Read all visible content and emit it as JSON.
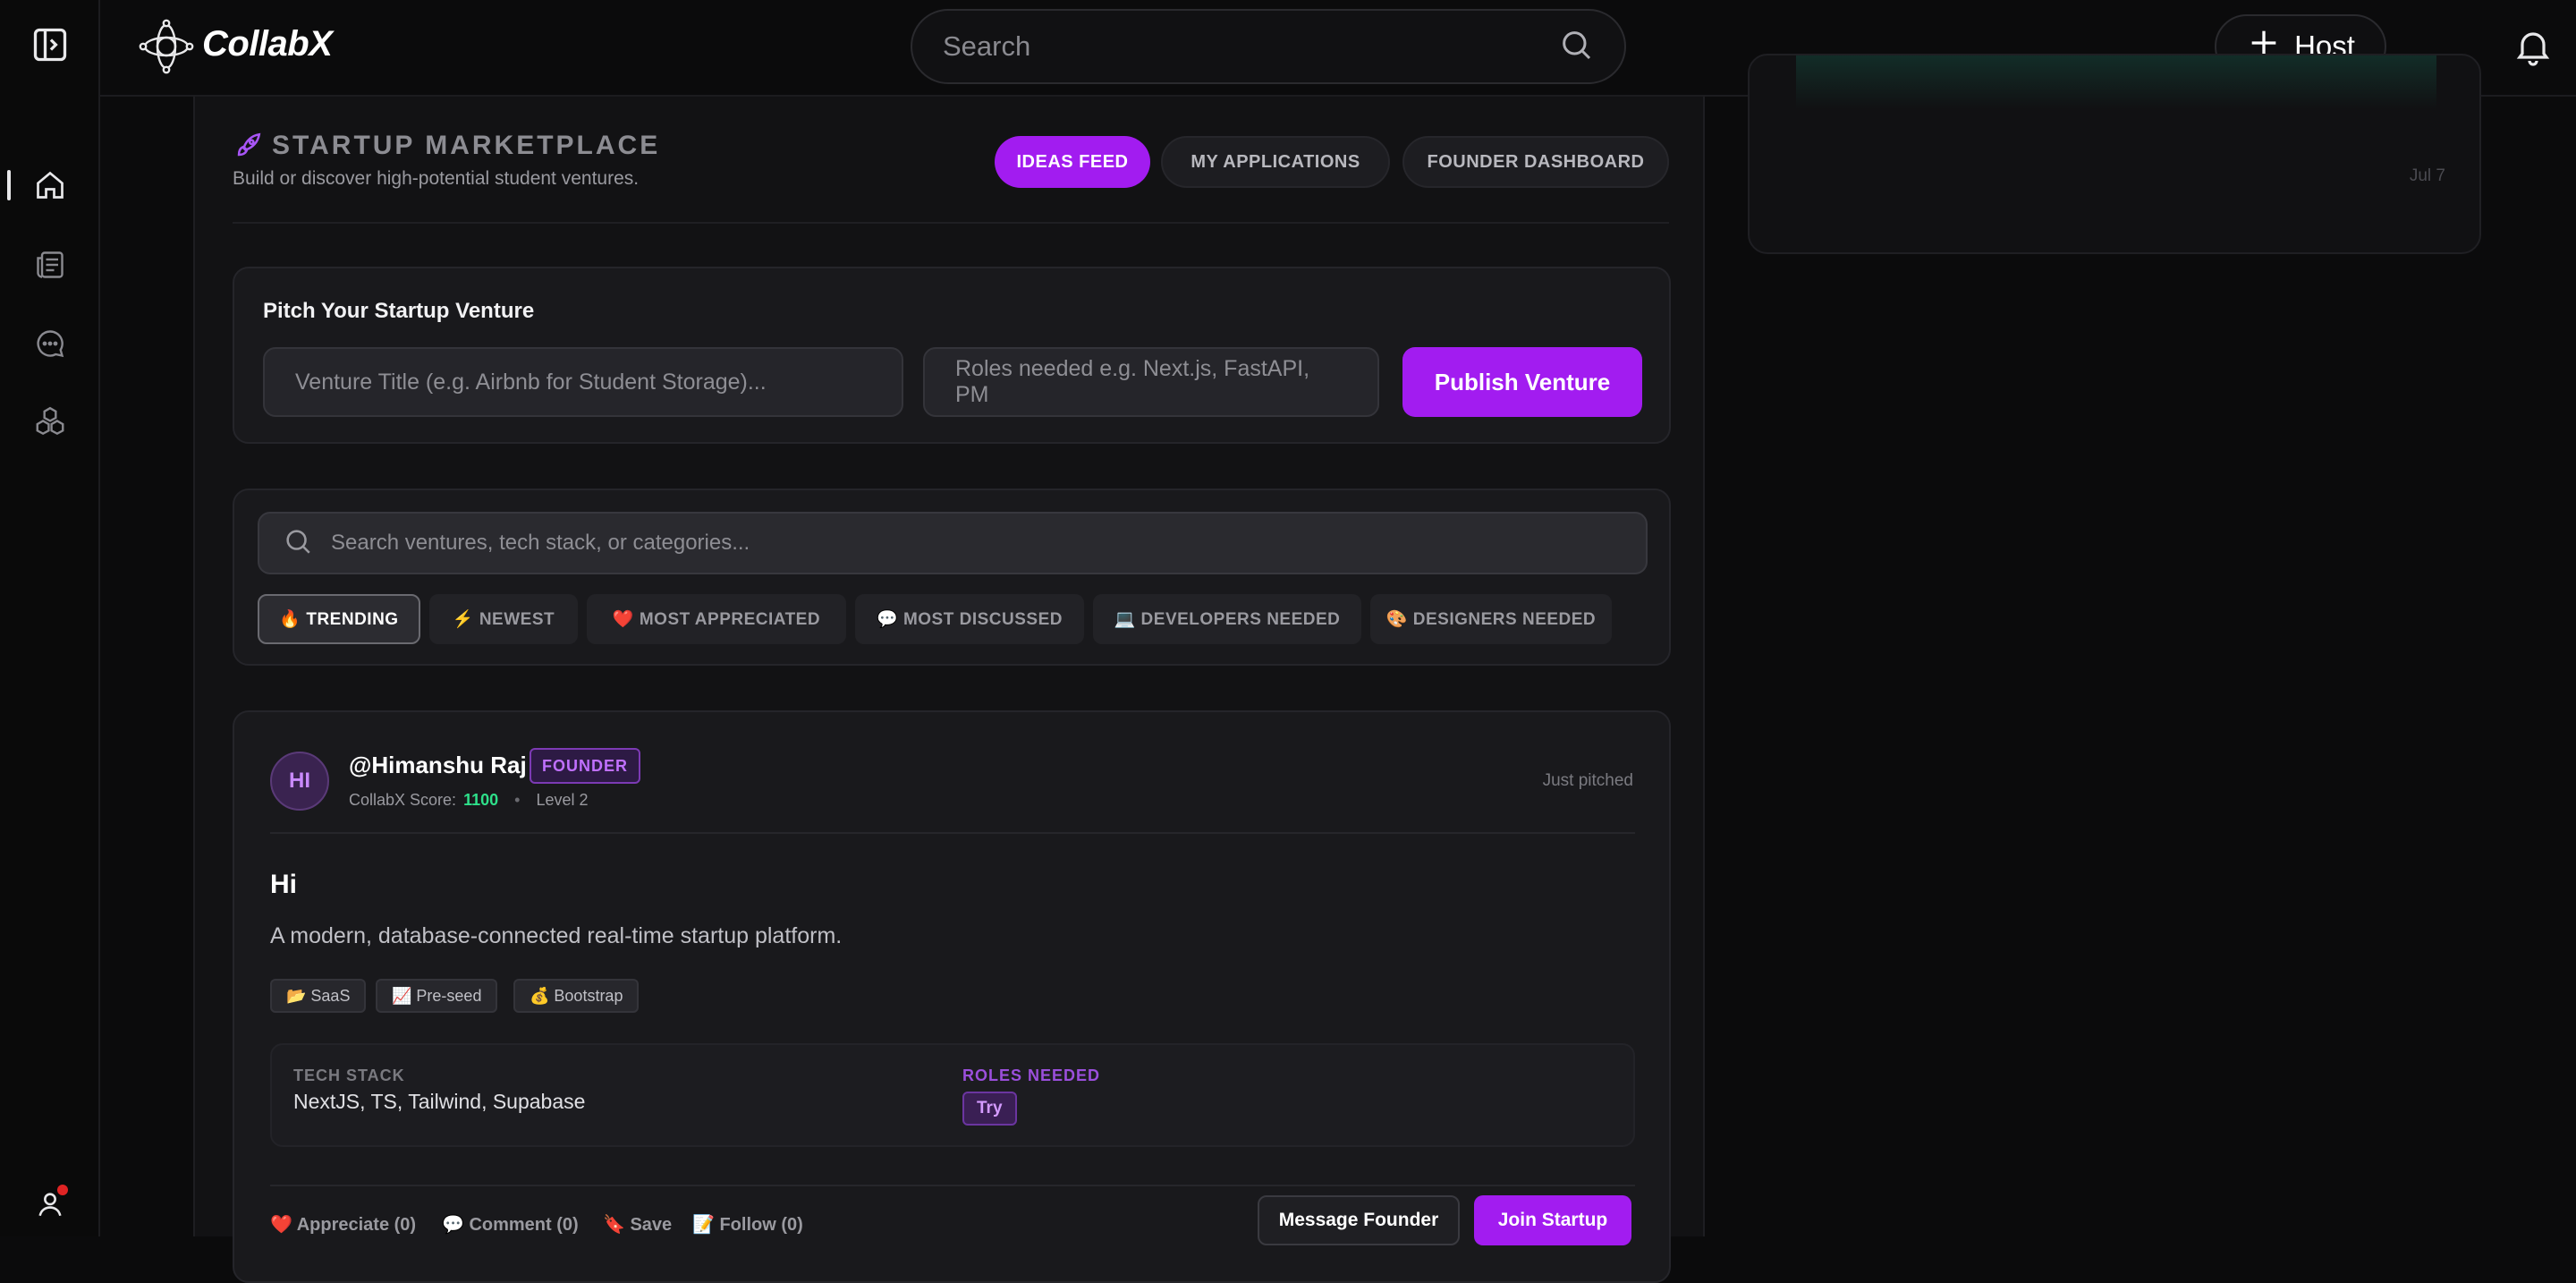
{
  "app": {
    "name": "CollabX"
  },
  "topbar": {
    "search_placeholder": "Search",
    "host_label": "Host"
  },
  "marketplace": {
    "title": "STARTUP MARKETPLACE",
    "subtitle": "Build or discover high-potential student ventures.",
    "tabs": [
      {
        "label": "IDEAS FEED",
        "active": true
      },
      {
        "label": "MY APPLICATIONS",
        "active": false
      },
      {
        "label": "FOUNDER DASHBOARD",
        "active": false
      }
    ]
  },
  "pitch": {
    "title": "Pitch Your Startup Venture",
    "title_placeholder": "Venture Title (e.g. Airbnb for Student Storage)...",
    "roles_placeholder": "Roles needed e.g. Next.js, FastAPI, PM",
    "publish_label": "Publish Venture"
  },
  "filters": {
    "search_placeholder": "Search ventures, tech stack, or categories...",
    "chips": [
      {
        "label": "🔥 TRENDING",
        "active": true
      },
      {
        "label": "⚡ NEWEST",
        "active": false
      },
      {
        "label": "❤️ MOST APPRECIATED",
        "active": false
      },
      {
        "label": "💬 MOST DISCUSSED",
        "active": false
      },
      {
        "label": "💻 DEVELOPERS NEEDED",
        "active": false
      },
      {
        "label": "🎨 DESIGNERS NEEDED",
        "active": false
      }
    ]
  },
  "post": {
    "avatar_initials": "HI",
    "handle": "@Himanshu Raj",
    "badge": "FOUNDER",
    "score_label": "CollabX Score:",
    "score_value": "1100",
    "level": "Level 2",
    "time": "Just pitched",
    "title": "Hi",
    "description": "A modern, database-connected real-time startup platform.",
    "tags": [
      "📂 SaaS",
      "📈 Pre-seed",
      "💰 Bootstrap"
    ],
    "tech_stack_label": "TECH STACK",
    "tech_stack": "NextJS, TS, Tailwind, Supabase",
    "roles_label": "ROLES NEEDED",
    "roles": [
      "Try"
    ],
    "actions": {
      "appreciate": "❤️ Appreciate (0)",
      "comment": "💬 Comment (0)",
      "save": "🔖 Save",
      "follow": "📝 Follow (0)"
    },
    "message_label": "Message Founder",
    "join_label": "Join Startup"
  },
  "right_card": {
    "date": "Jul 7"
  },
  "colors": {
    "accent": "#a21cf0",
    "score": "#2ee08a",
    "notification_dot": "#e02424"
  },
  "icons": [
    "sidebar-toggle-icon",
    "collabx-logo-icon",
    "search-icon",
    "plus-icon",
    "bell-icon",
    "user-icon",
    "home-icon",
    "newspaper-icon",
    "chat-icon",
    "cubes-icon",
    "profile-icon",
    "rocket-icon"
  ]
}
